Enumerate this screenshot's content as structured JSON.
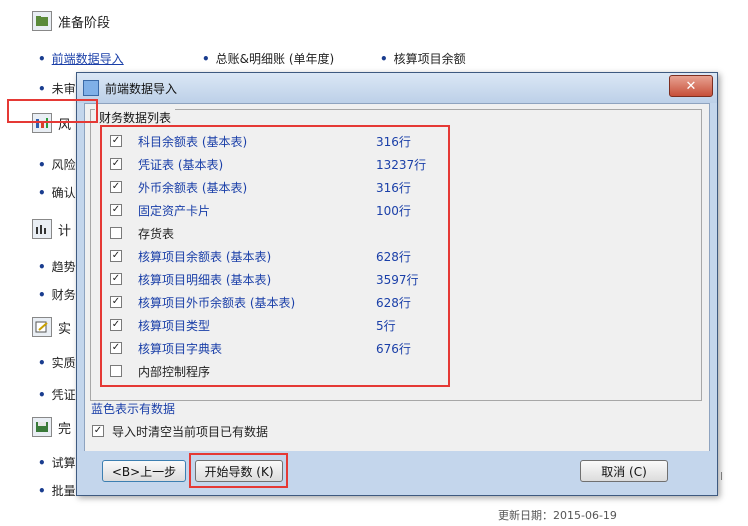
{
  "background": {
    "section1_title": "准备阶段",
    "link_row1": [
      "前端数据导入",
      "总账&明细账 (单年度)",
      "核算项目余额"
    ],
    "partial_items": [
      "未审",
      "风",
      "风险",
      "确认",
      "计",
      "趋势",
      "财务",
      "实",
      "实质",
      "凭证",
      "完",
      "试算",
      "批量"
    ],
    "footer_date": "更新日期：2015-06-19",
    "right_letter": "l"
  },
  "dialog": {
    "title": "前端数据导入",
    "close_symbol": "✕",
    "group_label": "财务数据列表",
    "rows": [
      {
        "name": "科目余额表 (基本表)",
        "count": "316行",
        "checked": true,
        "has_data": true
      },
      {
        "name": "凭证表 (基本表)",
        "count": "13237行",
        "checked": true,
        "has_data": true
      },
      {
        "name": "外币余额表 (基本表)",
        "count": "316行",
        "checked": true,
        "has_data": true
      },
      {
        "name": "固定资产卡片",
        "count": "100行",
        "checked": true,
        "has_data": true
      },
      {
        "name": "存货表",
        "count": "",
        "checked": false,
        "has_data": false
      },
      {
        "name": "核算项目余额表 (基本表)",
        "count": "628行",
        "checked": true,
        "has_data": true
      },
      {
        "name": "核算项目明细表 (基本表)",
        "count": "3597行",
        "checked": true,
        "has_data": true
      },
      {
        "name": "核算项目外币余额表 (基本表)",
        "count": "628行",
        "checked": true,
        "has_data": true
      },
      {
        "name": "核算项目类型",
        "count": "5行",
        "checked": true,
        "has_data": true
      },
      {
        "name": "核算项目字典表",
        "count": "676行",
        "checked": true,
        "has_data": true
      },
      {
        "name": "内部控制程序",
        "count": "",
        "checked": false,
        "has_data": false
      }
    ],
    "note": "蓝色表示有数据",
    "option_label": "导入时清空当前项目已有数据",
    "option_checked": true,
    "buttons": {
      "prev": "<B>上一步",
      "start": "开始导数 (K)",
      "cancel": "取消 (C)"
    }
  },
  "colors": {
    "highlight_red": "#e53935",
    "data_blue": "#1a3fa8",
    "dialog_frame": "#c4d6ec"
  }
}
